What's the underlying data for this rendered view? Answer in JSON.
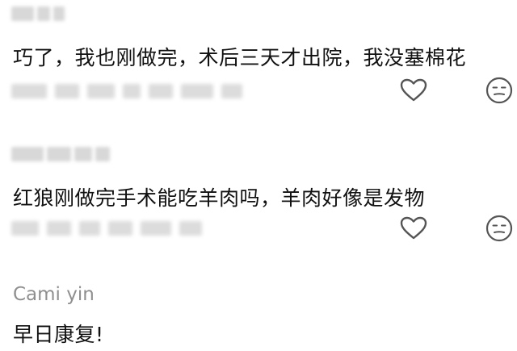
{
  "comments": [
    {
      "username": "",
      "text": "巧了，我也刚做完，术后三天才出院，我没塞棉花",
      "like_icon": "heart-outline-icon",
      "react_icon": "meh-face-icon"
    },
    {
      "username": "",
      "text": "红狼刚做完手术能吃羊肉吗，羊肉好像是发物",
      "like_icon": "heart-outline-icon",
      "react_icon": "meh-face-icon"
    },
    {
      "username": "Cami yin",
      "text": "早日康复!"
    }
  ],
  "colors": {
    "text": "#111111",
    "username": "#8f8f8f",
    "icon": "#555555",
    "blur": "#d8d8d8"
  }
}
